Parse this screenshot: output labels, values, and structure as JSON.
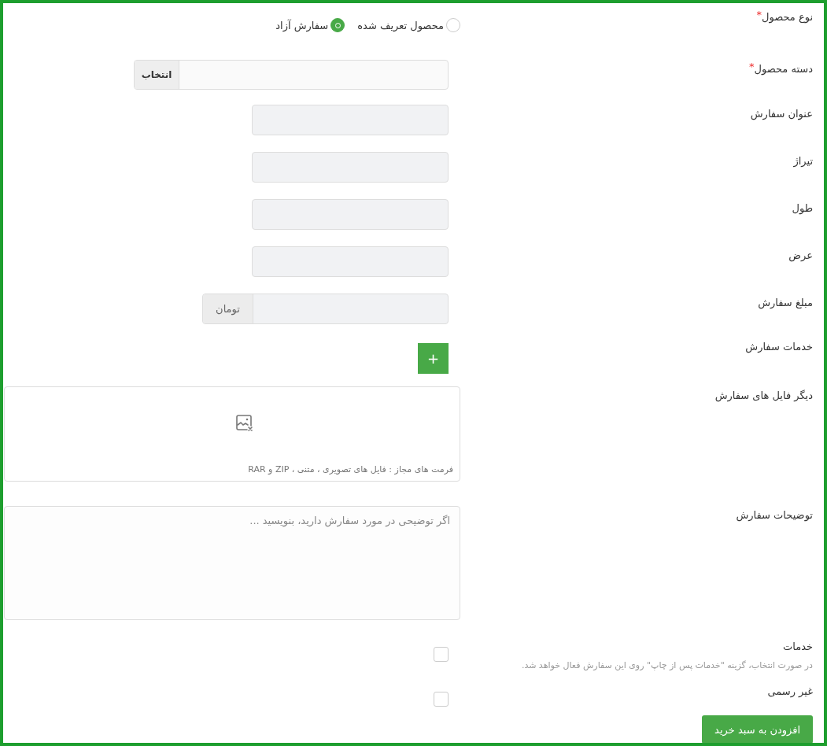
{
  "fields": [
    {
      "kind": "radio",
      "label": "نوع محصول",
      "required_mark": "*",
      "options": [
        {
          "label": "محصول تعریف شده",
          "selected": false
        },
        {
          "label": "سفارش آزاد",
          "selected": true
        }
      ]
    },
    {
      "kind": "picker",
      "label": "دسته محصول",
      "required_mark": "*",
      "button": "انتخاب"
    },
    {
      "kind": "text",
      "label": "عنوان سفارش"
    },
    {
      "kind": "text",
      "label": "تیراژ"
    },
    {
      "kind": "text",
      "label": "طول"
    },
    {
      "kind": "text",
      "label": "عرض"
    },
    {
      "kind": "addon",
      "label": "مبلغ سفارش",
      "addon": "تومان"
    },
    {
      "kind": "add",
      "label": "خدمات سفارش",
      "button": "+"
    },
    {
      "kind": "upload",
      "label": "دیگر فایل های سفارش",
      "hint": "فرمت های مجاز : فایل های تصویری ، متنی ، ZIP و RAR"
    },
    {
      "kind": "textarea",
      "label": "توضیحات سفارش",
      "placeholder": "اگر توضیحی در مورد سفارش دارید، بنویسید ..."
    }
  ],
  "checks": [
    {
      "label": "خدمات",
      "checked": false,
      "hint": "در صورت انتخاب، گزینه \"خدمات پس از چاپ\" روی این سفارش فعال خواهد شد."
    },
    {
      "label": "غیر رسمی",
      "checked": false
    }
  ],
  "submit": "افزودن به سبد خرید"
}
